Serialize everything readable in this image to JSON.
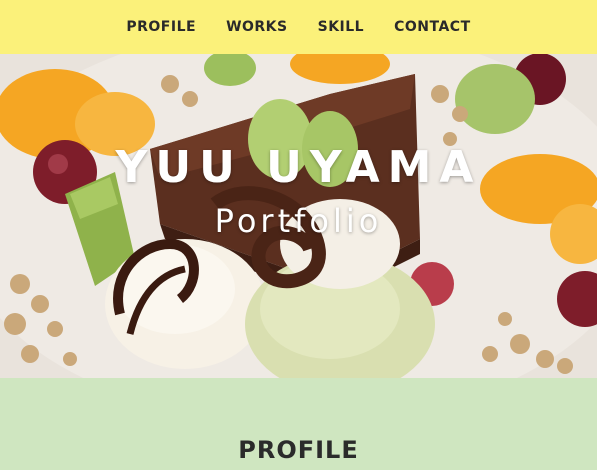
{
  "nav": {
    "items": [
      {
        "label": "PROFILE"
      },
      {
        "label": "WORKS"
      },
      {
        "label": "SKILL"
      },
      {
        "label": "CONTACT"
      }
    ]
  },
  "hero": {
    "title": "YUU UYAMA",
    "subtitle": "Portfolio",
    "image_subject": "dessert plate with chocolate cake, ice cream, grapes, orange and kiwi"
  },
  "profile": {
    "heading": "PROFILE"
  },
  "colors": {
    "nav_bg": "#fbf17a",
    "section_bg": "#cfe6c0",
    "text_dark": "#2b2b2b",
    "hero_text": "#ffffff"
  }
}
